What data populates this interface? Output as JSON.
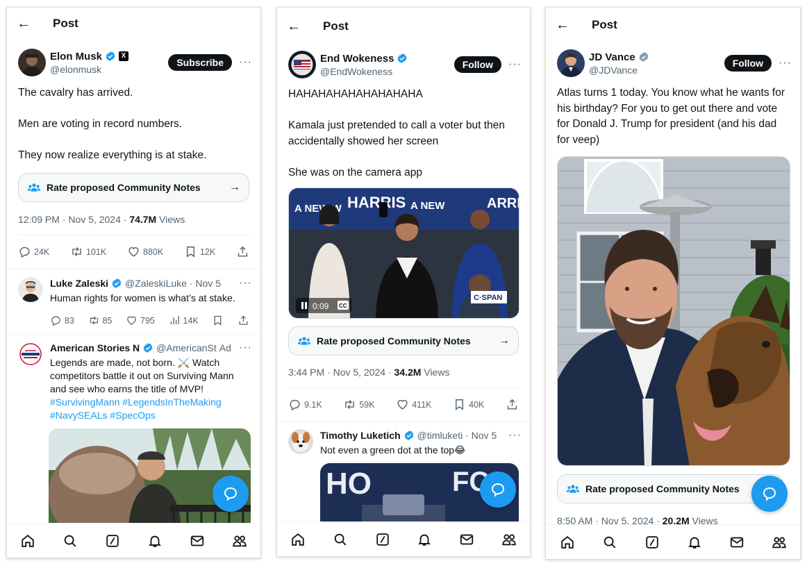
{
  "panels": [
    {
      "header_title": "Post",
      "author": {
        "name": "Elon Musk",
        "handle": "@elonmusk",
        "verified": true,
        "affiliate_badge": "X"
      },
      "action_button": "Subscribe",
      "text_lines": [
        "The cavalry has arrived.",
        "",
        "Men are voting in record numbers.",
        "",
        "They now realize everything is at stake."
      ],
      "community_notes_label": "Rate proposed Community Notes",
      "timestamp": "12:09 PM · Nov 5, 2024 · ",
      "views_count": "74.7M",
      "views_label": " Views",
      "stats": {
        "replies": "24K",
        "reposts": "101K",
        "likes": "880K",
        "bookmarks": "12K"
      },
      "reply": {
        "name": "Luke Zaleski",
        "meta": "@ZaleskiLuke · Nov 5",
        "text": "Human rights for women is what’s at stake.",
        "stats": {
          "replies": "83",
          "reposts": "85",
          "likes": "795",
          "views": "14K"
        }
      },
      "ad": {
        "name": "American Stories N",
        "meta": "@AmericanSt",
        "ad_label": "Ad",
        "text": "Legends are made, not born. ⚔️ Watch competitors battle it out on Surviving Mann and see who earns the title of MVP!",
        "hashtags": "#SurvivingMann #LegendsInTheMaking #NavySEALs #SpecOps"
      }
    },
    {
      "header_title": "Post",
      "author": {
        "name": "End Wokeness",
        "handle": "@EndWokeness",
        "verified": true
      },
      "action_button": "Follow",
      "text_lines": [
        "HAHAHAHAHAHAHAHAHA",
        "",
        "Kamala just pretended to call a voter but then accidentally showed her screen",
        "",
        "She was on the camera app"
      ],
      "video": {
        "duration": "0:09",
        "cc_label": "CC",
        "network_logo": "C·SPAN",
        "banner_text": "HARRIS"
      },
      "community_notes_label": "Rate proposed Community Notes",
      "timestamp": "3:44 PM · Nov 5, 2024 · ",
      "views_count": "34.2M",
      "views_label": " Views",
      "stats": {
        "replies": "9.1K",
        "reposts": "59K",
        "likes": "411K",
        "bookmarks": "40K"
      },
      "reply": {
        "name": "Timothy Luketich",
        "meta": "@timluketi · Nov 5",
        "text": "Not even a green dot at the top😂"
      }
    },
    {
      "header_title": "Post",
      "author": {
        "name": "JD Vance",
        "handle": "@JDVance",
        "verified": true
      },
      "action_button": "Follow",
      "text_lines": [
        "Atlas turns 1 today. You know what he wants for his birthday? For you to get out there and vote for Donald J. Trump for president (and his dad for veep)"
      ],
      "community_notes_label": "Rate proposed Community Notes",
      "timestamp": "8:50 AM · Nov 5, 2024 · ",
      "views_count": "20.2M",
      "views_label": " Views"
    }
  ],
  "colors": {
    "accent": "#1d9bf0",
    "text": "#0f1419",
    "muted": "#536471",
    "border": "#cfd9de"
  },
  "icons": [
    "back-arrow-icon",
    "verified-badge-icon",
    "reply-icon",
    "repost-icon",
    "like-icon",
    "bookmark-icon",
    "share-icon",
    "views-icon",
    "community-notes-icon",
    "compose-chat-icon",
    "home-icon",
    "search-icon",
    "grok-icon",
    "notifications-icon",
    "messages-icon",
    "communities-icon"
  ]
}
